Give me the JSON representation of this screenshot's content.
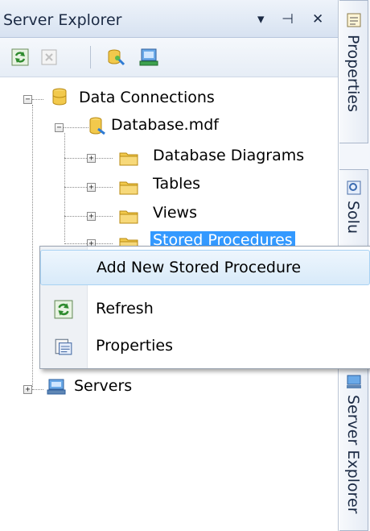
{
  "panel": {
    "title": "Server Explorer",
    "title_controls": {
      "dropdown": "▾",
      "pin": "⊣",
      "close": "✕"
    }
  },
  "toolbar": {
    "buttons": [
      {
        "name": "refresh-icon"
      },
      {
        "name": "stop-icon"
      },
      {
        "name": "connect-to-database-icon"
      },
      {
        "name": "connect-to-server-icon"
      }
    ]
  },
  "tree": {
    "data_connections": "Data Connections",
    "database": "Database.mdf",
    "children": [
      "Database Diagrams",
      "Tables",
      "Views",
      "Stored Procedures"
    ],
    "servers": "Servers"
  },
  "context_menu": {
    "add_new": "Add New Stored Procedure",
    "refresh": "Refresh",
    "properties": "Properties"
  },
  "side_tabs": {
    "properties": "Properties",
    "solution": "Solu",
    "server_explorer": "Server Explorer"
  },
  "colors": {
    "selection": "#3399ff",
    "menu_highlight": "#d8eaf9",
    "folder": "#f2c94c"
  }
}
